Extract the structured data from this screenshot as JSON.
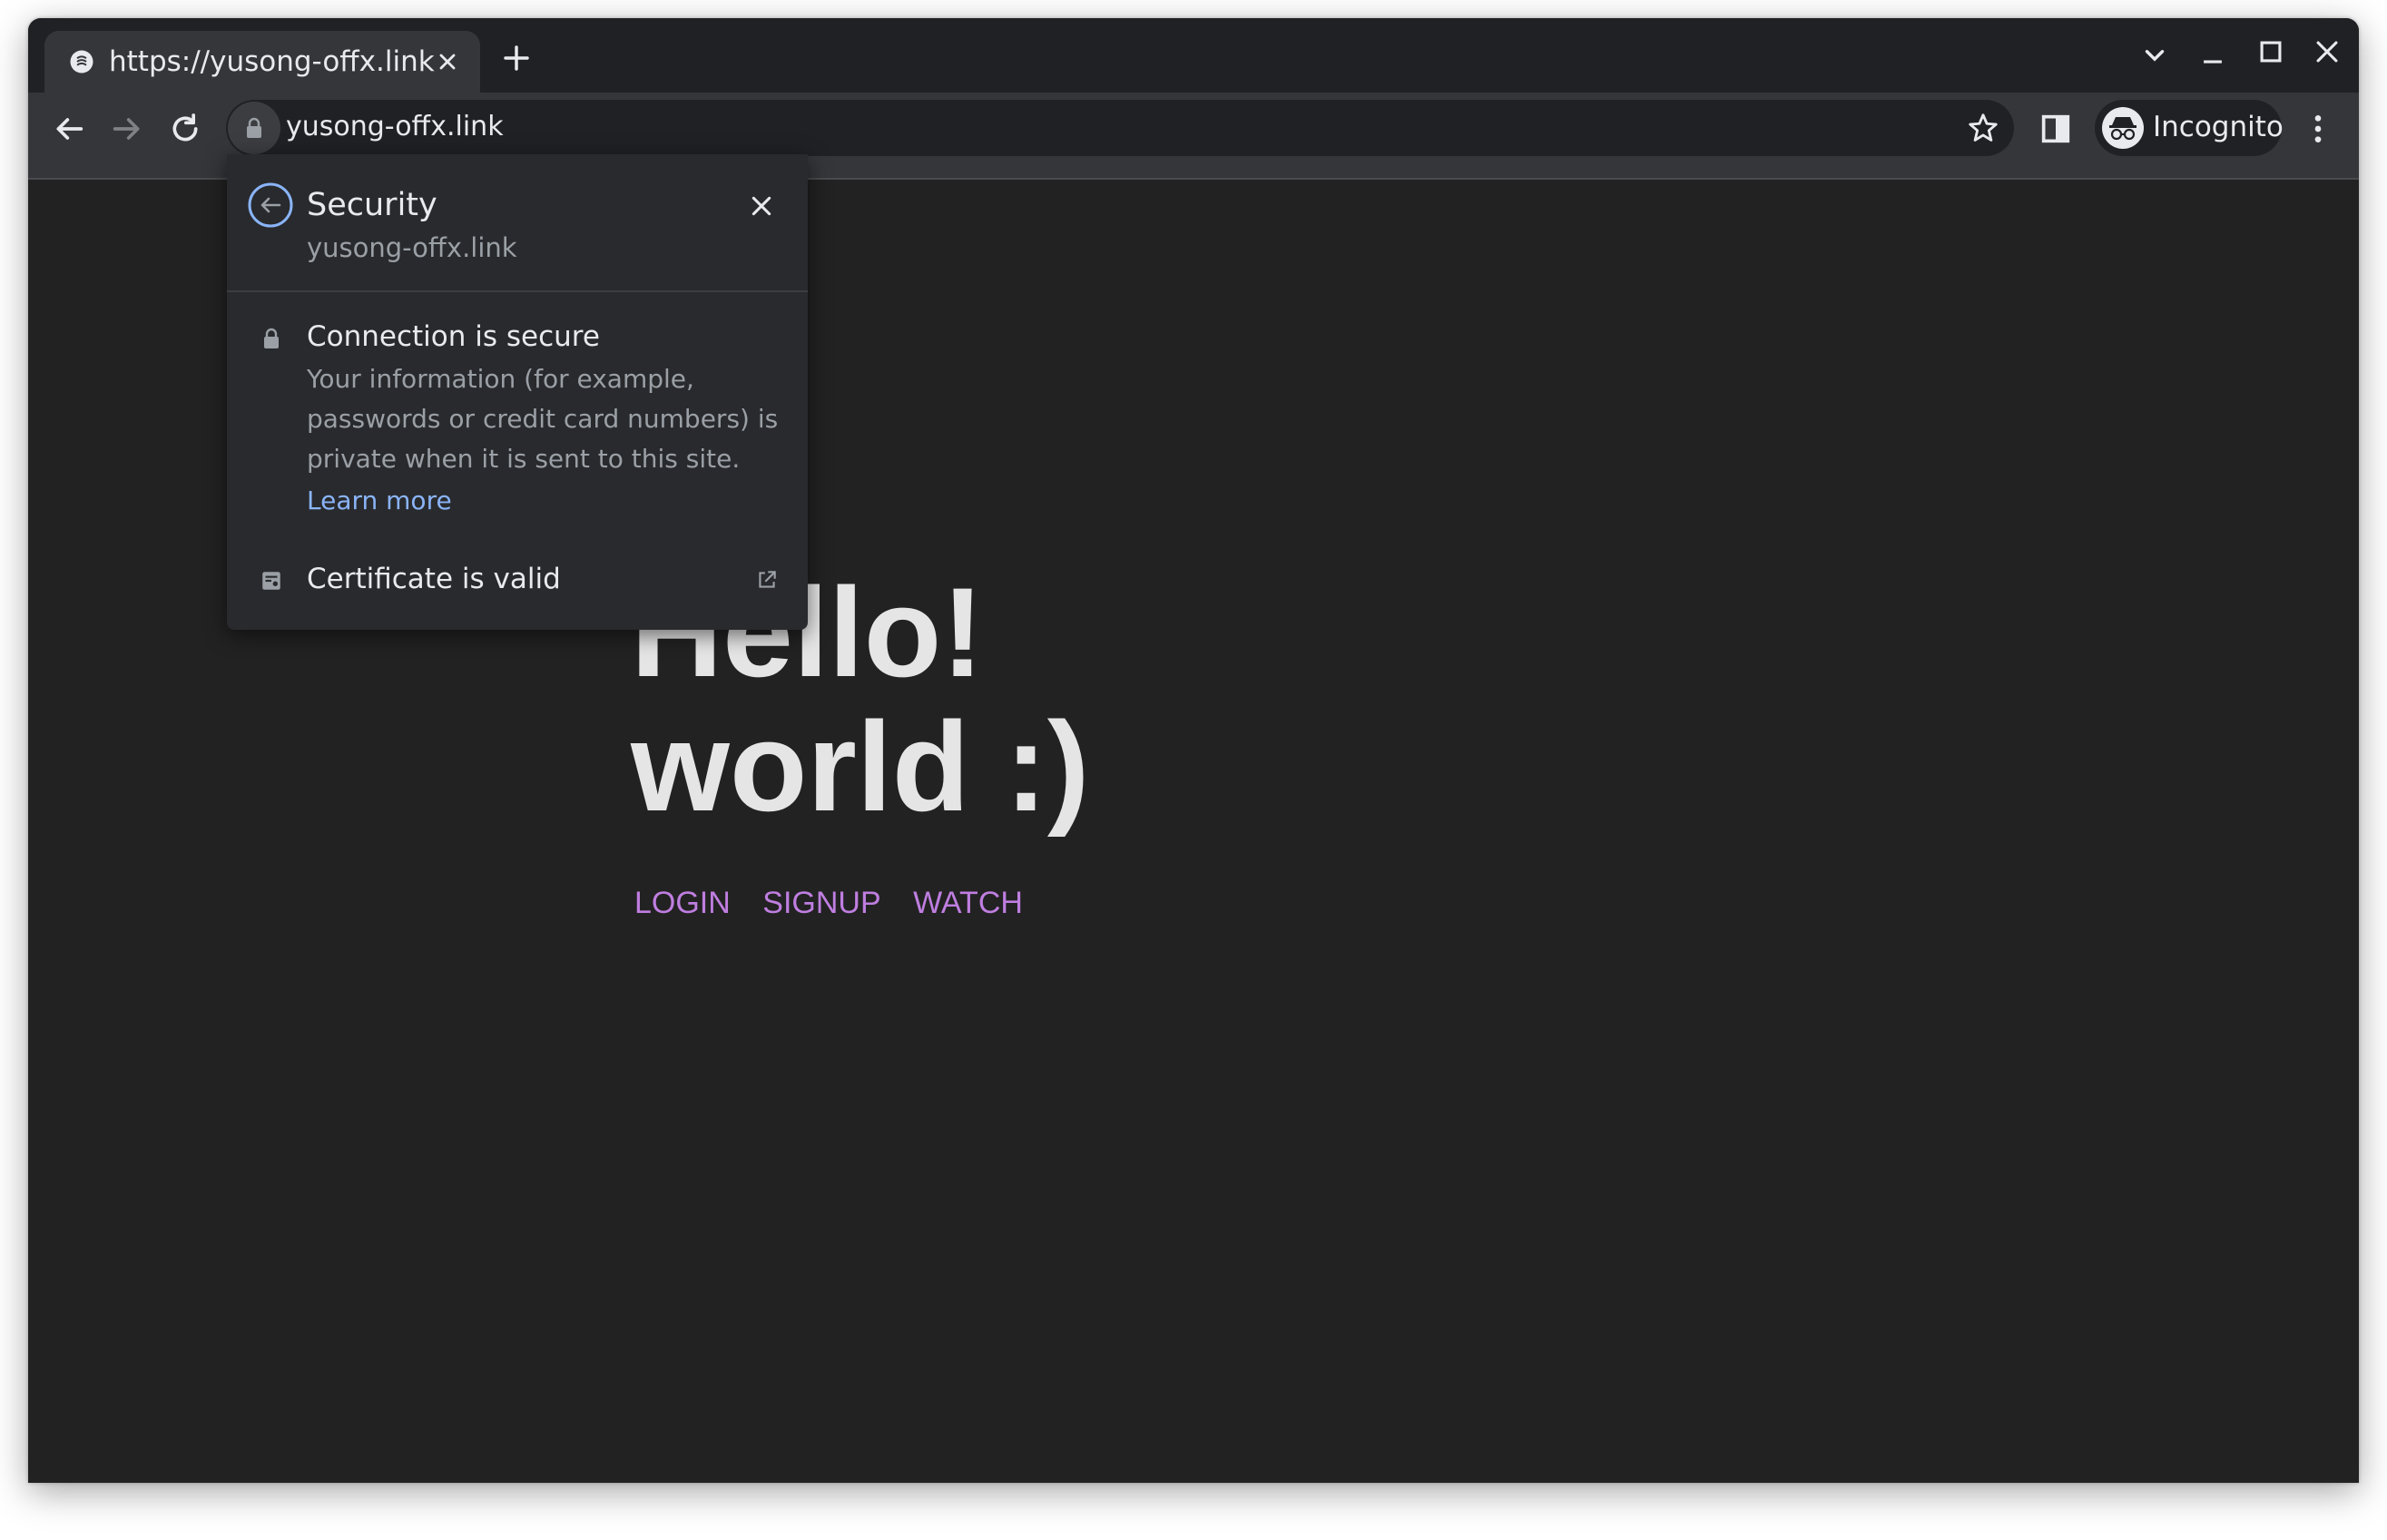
{
  "browser": {
    "tab": {
      "title": "https://yusong-offx.link",
      "favicon": "site-favicon-icon"
    },
    "address_bar": {
      "url": "yusong-offx.link",
      "security_icon": "lock-icon"
    },
    "profile": {
      "label": "Incognito",
      "icon": "incognito-icon"
    },
    "icons": {
      "back": "arrow-left-icon",
      "forward": "arrow-right-icon",
      "reload": "reload-icon",
      "bookmark": "star-icon",
      "side_panel": "side-panel-icon",
      "menu": "kebab-menu-icon",
      "new_tab": "plus-icon",
      "tab_search": "chevron-down-icon",
      "minimize": "minimize-icon",
      "maximize": "maximize-icon",
      "close": "close-icon"
    }
  },
  "security_popup": {
    "title": "Security",
    "site": "yusong-offx.link",
    "connection": {
      "title": "Connection is secure",
      "description": "Your information (for example, passwords or credit card numbers) is private when it is sent to this site.",
      "link": "Learn more"
    },
    "certificate": {
      "label": "Certificate is valid"
    }
  },
  "page": {
    "hero_line1": "Hello!",
    "hero_line2": "world :)",
    "links": [
      "LOGIN",
      "SIGNUP",
      "WATCH"
    ]
  },
  "colors": {
    "page_background": "#222222",
    "link": "#bf7ee0",
    "accent_link": "#8ab4f8",
    "chrome_dark": "#202124"
  }
}
